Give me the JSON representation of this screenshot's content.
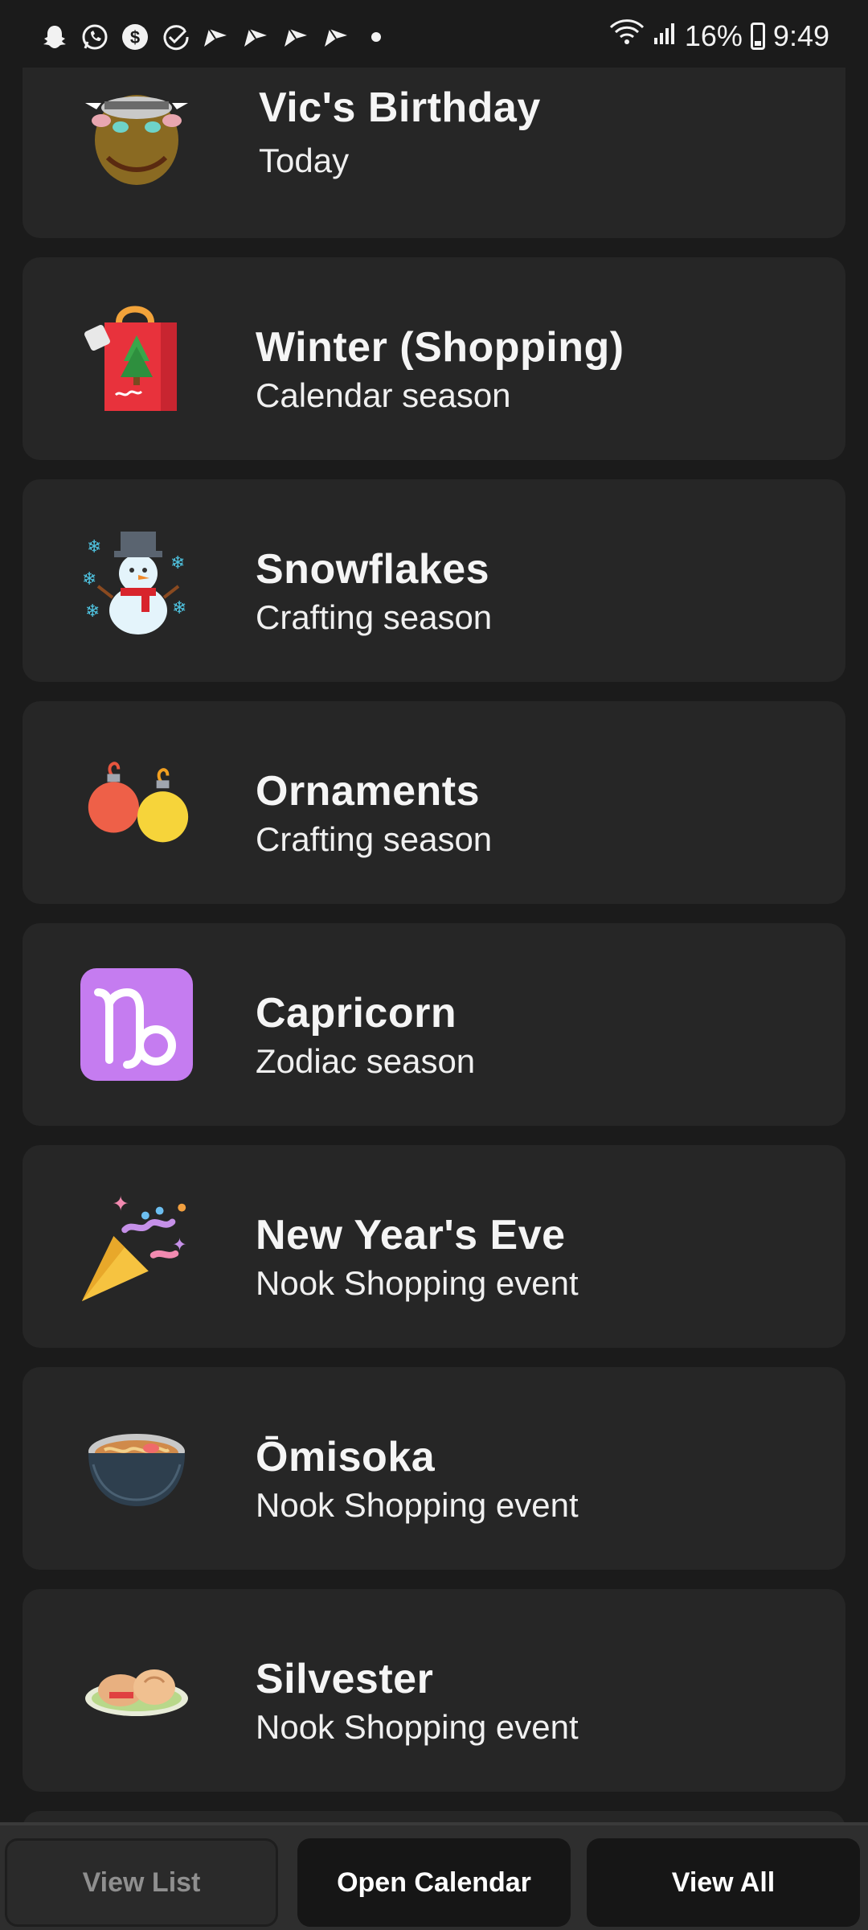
{
  "status_bar": {
    "battery": "16%",
    "time": "9:49",
    "notification_icons": [
      "snapchat-icon",
      "whatsapp-icon",
      "cash-app-icon",
      "check-circle-icon",
      "shortcut-icon",
      "shortcut-icon",
      "shortcut-icon",
      "shortcut-icon"
    ]
  },
  "events": [
    {
      "title": "Vic's Birthday",
      "subtitle": "Today",
      "icon": "bull-villager-icon"
    },
    {
      "title": "Winter (Shopping)",
      "subtitle": "Calendar season",
      "icon": "shopping-bag-icon"
    },
    {
      "title": "Snowflakes",
      "subtitle": "Crafting season",
      "icon": "snowman-icon"
    },
    {
      "title": "Ornaments",
      "subtitle": "Crafting season",
      "icon": "ornaments-icon"
    },
    {
      "title": "Capricorn",
      "subtitle": "Zodiac season",
      "icon": "capricorn-icon"
    },
    {
      "title": "New Year's Eve",
      "subtitle": "Nook Shopping event",
      "icon": "party-popper-icon"
    },
    {
      "title": "Ōmisoka",
      "subtitle": "Nook Shopping event",
      "icon": "noodle-bowl-icon"
    },
    {
      "title": "Silvester",
      "subtitle": "Nook Shopping event",
      "icon": "food-plate-icon"
    }
  ],
  "bottom_bar": {
    "view_list": "View List",
    "open_calendar": "Open Calendar",
    "view_all": "View All"
  },
  "colors": {
    "background": "#1b1b1b",
    "card": "#262626",
    "capricorn": "#c57cf0"
  }
}
